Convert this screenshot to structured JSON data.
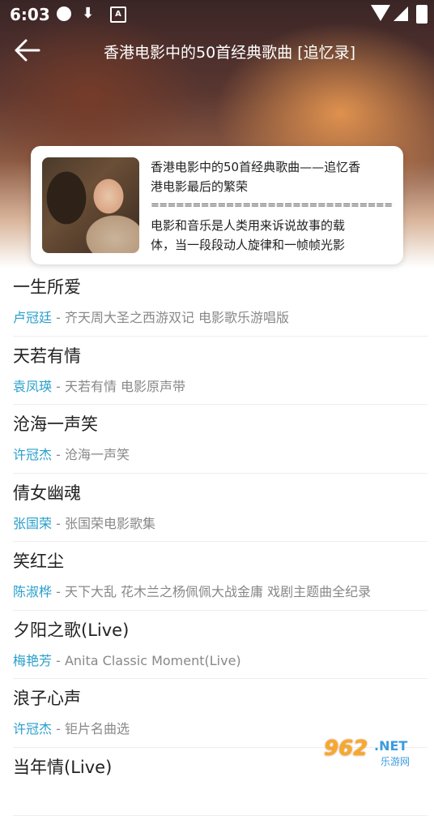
{
  "status_bar": {
    "time": "6:03",
    "notification_icon": "A"
  },
  "header": {
    "title": "香港电影中的50首经典歌曲 [追忆录]"
  },
  "card": {
    "line1": "香港电影中的50首经典歌曲——追忆香",
    "line2": "港电影最后的繁荣",
    "separator": "================================",
    "line3": "电影和音乐是人类用来诉说故事的载",
    "line4": "体，当一段段动人旋律和一帧帧光影"
  },
  "songs": [
    {
      "title": "一生所爱",
      "artist": "卢冠廷",
      "album": " - 齐天周大圣之西游双记 电影歌乐游唱版"
    },
    {
      "title": "天若有情",
      "artist": "袁凤瑛",
      "album": " - 天若有情 电影原声带"
    },
    {
      "title": "沧海一声笑",
      "artist": "许冠杰",
      "album": " - 沧海一声笑"
    },
    {
      "title": "倩女幽魂",
      "artist": "张国荣",
      "album": " - 张国荣电影歌集"
    },
    {
      "title": "笑红尘",
      "artist": "陈淑桦",
      "album": " - 天下大乱 花木兰之杨佩佩大战金庸 戏剧主题曲全纪录"
    },
    {
      "title": "夕阳之歌(Live)",
      "artist": "梅艳芳",
      "album": " - Anita Classic Moment(Live)"
    },
    {
      "title": "浪子心声",
      "artist": "许冠杰",
      "album": " - 钜片名曲选"
    },
    {
      "title": "当年情(Live)",
      "artist": "",
      "album": ""
    }
  ],
  "watermark": {
    "number": "962",
    "net": ".NET",
    "sub": "乐游网"
  },
  "colors": {
    "artist": "#2a9fcb",
    "title": "#222222",
    "meta": "#888888"
  }
}
